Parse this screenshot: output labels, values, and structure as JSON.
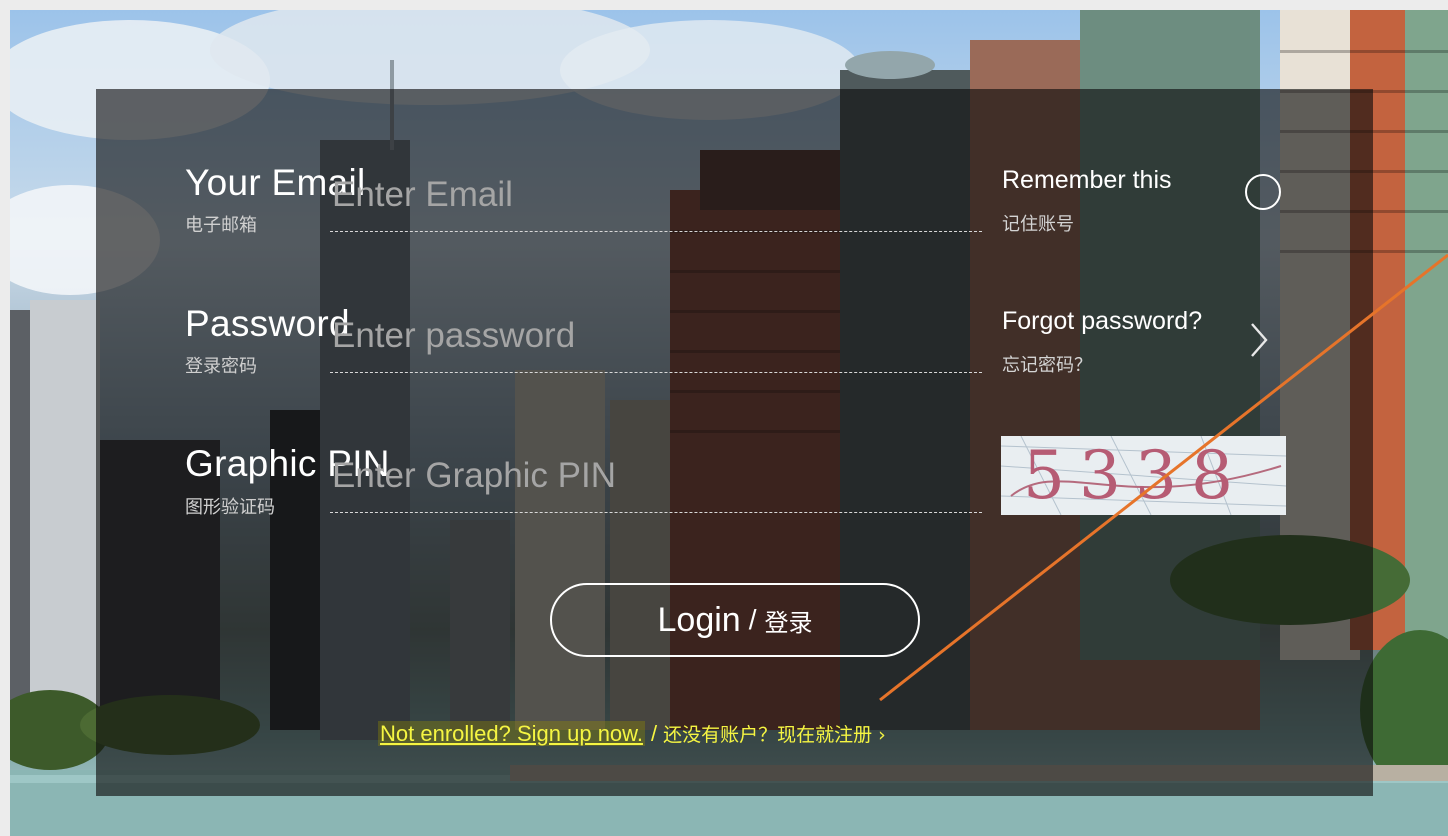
{
  "form": {
    "email": {
      "label": "Your Email",
      "sublabel": "电子邮箱",
      "placeholder": "Enter Email"
    },
    "password": {
      "label": "Password",
      "sublabel": "登录密码",
      "placeholder": "Enter password"
    },
    "pin": {
      "label": "Graphic PIN",
      "sublabel": "图形验证码",
      "placeholder": "Enter Graphic PIN"
    }
  },
  "remember": {
    "title": "Remember this",
    "subtitle": "记住账号",
    "icon": "radio-circle-icon"
  },
  "forgot": {
    "title": "Forgot password?",
    "subtitle": "忘记密码？",
    "icon": "chevron-right-icon"
  },
  "captcha": {
    "code": "5338"
  },
  "login": {
    "label": "Login",
    "separator": "/",
    "label_cn": "登录"
  },
  "signup": {
    "link_text": "Not enrolled? Sign up now.",
    "separator": "/",
    "text_cn": "还没有账户？现在就注册 ›"
  },
  "colors": {
    "panel_overlay": "rgba(12,12,12,0.62)",
    "signup_text": "#f5f542",
    "annotation_arrow": "#e6742a"
  }
}
